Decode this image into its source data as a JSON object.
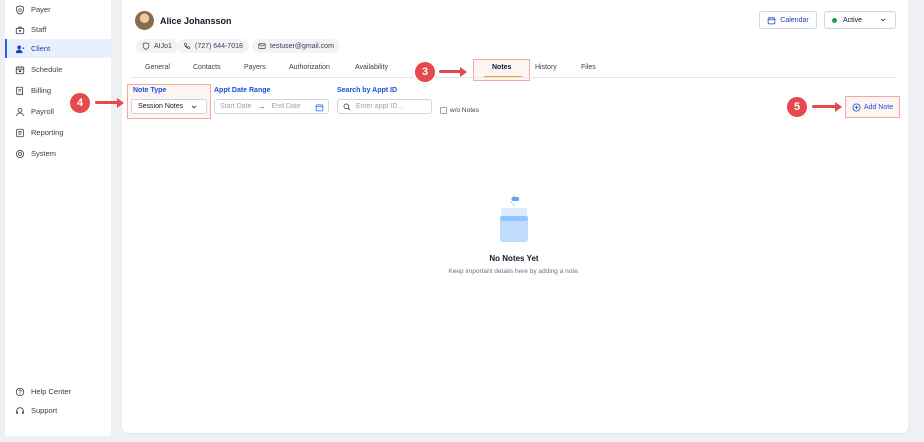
{
  "sidebar": {
    "items": [
      {
        "label": "Payer",
        "icon": "shield-dollar-icon"
      },
      {
        "label": "Staff",
        "icon": "staff-icon"
      },
      {
        "label": "Client",
        "icon": "client-icon"
      },
      {
        "label": "Schedule",
        "icon": "calendar-icon"
      },
      {
        "label": "Billing",
        "icon": "billing-icon"
      },
      {
        "label": "Payroll",
        "icon": "payroll-icon"
      },
      {
        "label": "Reporting",
        "icon": "report-icon"
      },
      {
        "label": "System",
        "icon": "system-icon"
      }
    ],
    "active": "Client",
    "bottom": [
      {
        "label": "Help Center",
        "icon": "help-icon"
      },
      {
        "label": "Support",
        "icon": "headset-icon"
      }
    ]
  },
  "client": {
    "name": "Alice Johansson",
    "id": "AIJo1",
    "phone": "(727) 644-7018",
    "email": "testuser@gmail.com"
  },
  "header": {
    "calendar_label": "Calendar",
    "status": "Active",
    "status_color": "#16a34a"
  },
  "tabs": [
    "General",
    "Contacts",
    "Payers",
    "Authorization",
    "Availability",
    "Notes",
    "History",
    "Files"
  ],
  "active_tab": "Notes",
  "filters": {
    "note_type_label": "Note Type",
    "note_type_value": "Session Notes",
    "date_range_label": "Appt Date Range",
    "start_placeholder": "Start Date",
    "end_placeholder": "End Date",
    "search_label": "Search by Appt ID",
    "search_placeholder": "Enter appt ID...",
    "wo_notes_label": "w/o Notes"
  },
  "add_note_label": "Add Note",
  "empty_state": {
    "title": "No Notes Yet",
    "subtitle": "Keep important details here by adding a note."
  },
  "steps": [
    "3",
    "4",
    "5"
  ],
  "colors": {
    "accent": "#1d4ed8",
    "tab_indicator": "#f59e0b",
    "step_badge": "#e5484d"
  }
}
